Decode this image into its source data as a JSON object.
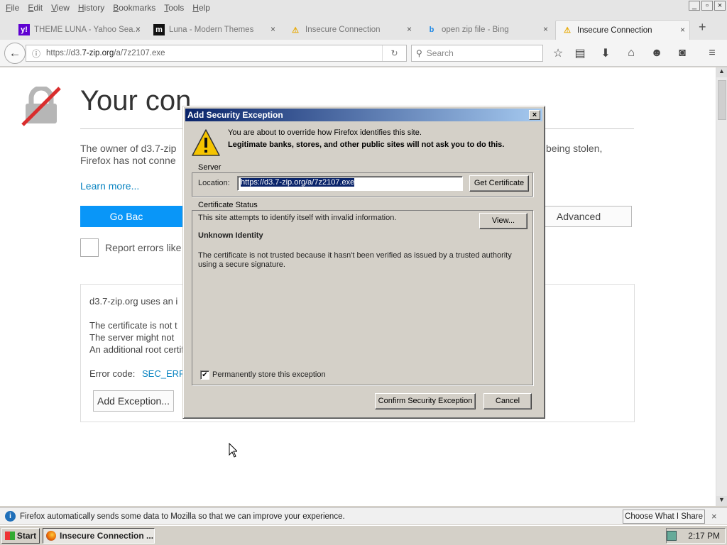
{
  "menu": [
    "File",
    "Edit",
    "View",
    "History",
    "Bookmarks",
    "Tools",
    "Help"
  ],
  "window_controls": {
    "minimize": "_",
    "maximize": "▫",
    "close": "×"
  },
  "tabs": [
    {
      "icon": "y!",
      "icon_color": "#5f01d1",
      "label": "THEME LUNA - Yahoo Sea..."
    },
    {
      "icon": "m",
      "icon_color": "#111111",
      "label": "Luna - Modern Themes"
    },
    {
      "icon": "⚠",
      "icon_color": "#e8a800",
      "label": "Insecure Connection"
    },
    {
      "icon": "b",
      "icon_color": "#1e88e5",
      "label": "open zip file - Bing"
    },
    {
      "icon": "⚠",
      "icon_color": "#e8a800",
      "label": "Insecure Connection",
      "active": true
    }
  ],
  "tab_close": "×",
  "new_tab": "+",
  "nav": {
    "back": "←",
    "url_prefix": "https://d3.",
    "url_domain": "7-zip.org",
    "url_path": "/a/7z2107.exe",
    "reload": "↻",
    "search_icon": "⚲",
    "search_placeholder": "Search"
  },
  "toolbar_icons": [
    "star-icon",
    "reading-list-icon",
    "download-icon",
    "home-icon",
    "sync-icon",
    "pocket-icon",
    "hamburger-menu-icon"
  ],
  "page": {
    "title": "Your con",
    "para_left": "The owner of d3.7-zip",
    "para_left2": "Firefox has not conne",
    "para_right": "being stolen,",
    "learn_more": "Learn more...",
    "go_back": "Go Bac",
    "advanced": "Advanced",
    "report": "Report errors like",
    "adv_line1": "d3.7-zip.org uses an i",
    "adv_line2": "The certificate is not t",
    "adv_line3": "The server might not",
    "adv_line4": "An additional root certificate may need to be imported.",
    "error_code_label": "Error code:",
    "error_code": "SEC_ERROR_UNKNOWN_ISSUER",
    "add_exception": "Add Exception..."
  },
  "dialog": {
    "title": "Add Security Exception",
    "close": "×",
    "warning1": "You are about to override how Firefox identifies this site.",
    "warning2": "Legitimate banks, stores, and other public sites will not ask you to do this.",
    "server_label": "Server",
    "location_label": "Location:",
    "location_value": "https://d3.7-zip.org/a/7z2107.exe",
    "get_certificate": "Get Certificate",
    "cert_status_label": "Certificate Status",
    "cert_line1": "This site attempts to identify itself with invalid information.",
    "view": "View...",
    "unknown_identity": "Unknown Identity",
    "cert_explanation": "The certificate is not trusted because it hasn't been verified as issued by a trusted authority using a secure signature.",
    "checkbox_checked": "✔",
    "permanent_label": "Permanently store this exception",
    "confirm": "Confirm Security Exception",
    "cancel": "Cancel"
  },
  "notification": {
    "icon": "i",
    "message": "Firefox automatically sends some data to Mozilla so that we can improve your experience.",
    "button": "Choose What I Share",
    "close": "×"
  },
  "taskbar": {
    "start": "Start",
    "task": "Insecure Connection ...",
    "time": "2:17 PM"
  },
  "colors": {
    "accent": "#0996f8",
    "link": "#0a84c1",
    "dialog_title": "#0a246a",
    "warning": "#f5c400",
    "broken_lock": "#d92d2d"
  }
}
